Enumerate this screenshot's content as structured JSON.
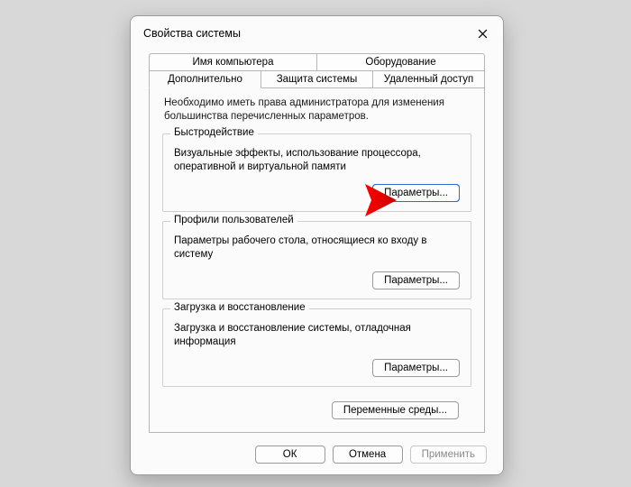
{
  "window": {
    "title": "Свойства системы"
  },
  "tabs": {
    "computer_name": "Имя компьютера",
    "hardware": "Оборудование",
    "advanced": "Дополнительно",
    "protection": "Защита системы",
    "remote": "Удаленный доступ"
  },
  "info_text": "Необходимо иметь права администратора для изменения большинства перечисленных параметров.",
  "groups": {
    "performance": {
      "title": "Быстродействие",
      "desc": "Визуальные эффекты, использование процессора, оперативной и виртуальной памяти",
      "button": "Параметры..."
    },
    "profiles": {
      "title": "Профили пользователей",
      "desc": "Параметры рабочего стола, относящиеся ко входу в систему",
      "button": "Параметры..."
    },
    "startup": {
      "title": "Загрузка и восстановление",
      "desc": "Загрузка и восстановление системы, отладочная информация",
      "button": "Параметры..."
    }
  },
  "env_button": "Переменные среды...",
  "footer": {
    "ok": "ОК",
    "cancel": "Отмена",
    "apply": "Применить"
  },
  "annotation": {
    "arrow_color": "#ff0000"
  }
}
